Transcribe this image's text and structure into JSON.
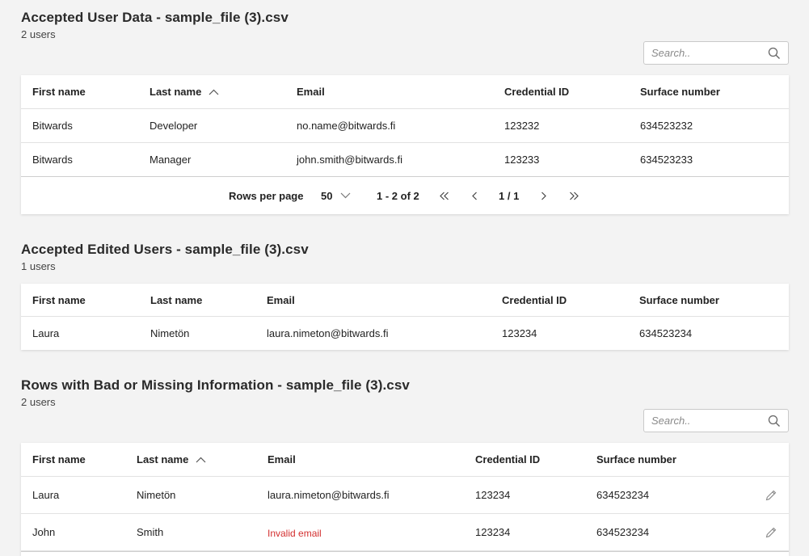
{
  "accepted": {
    "title": "Accepted User Data - sample_file (3).csv",
    "count": "2 users",
    "search_placeholder": "Search..",
    "headers": [
      "First name",
      "Last name",
      "Email",
      "Credential ID",
      "Surface number"
    ],
    "rows": [
      [
        "Bitwards",
        "Developer",
        "no.name@bitwards.fi",
        "123232",
        "634523232"
      ],
      [
        "Bitwards",
        "Manager",
        "john.smith@bitwards.fi",
        "123233",
        "634523233"
      ]
    ],
    "pagination": {
      "rows_per_page_label": "Rows per page",
      "rows_per_page_value": "50",
      "range": "1 - 2 of 2",
      "page": "1 / 1"
    }
  },
  "edited": {
    "title": "Accepted Edited Users - sample_file (3).csv",
    "count": "1 users",
    "headers": [
      "First name",
      "Last name",
      "Email",
      "Credential ID",
      "Surface number"
    ],
    "rows": [
      [
        "Laura",
        "Nimetön",
        "laura.nimeton@bitwards.fi",
        "123234",
        "634523234"
      ]
    ]
  },
  "bad": {
    "title": "Rows with Bad or Missing Information - sample_file (3).csv",
    "count": "2 users",
    "search_placeholder": "Search..",
    "headers": [
      "First name",
      "Last name",
      "Email",
      "Credential ID",
      "Surface number"
    ],
    "rows": [
      [
        "Laura",
        "Nimetön",
        "laura.nimeton@bitwards.fi",
        "123234",
        "634523234"
      ],
      [
        "John",
        "Smith",
        "Invalid email",
        "123234",
        "634523234"
      ]
    ]
  },
  "colors": {
    "error": "#d32f2f",
    "background": "#f3f3f3",
    "card": "#ffffff"
  },
  "icons": {
    "search": "search-icon",
    "sort": "sort-ascending-icon",
    "dropdown": "chevron-down-icon",
    "first": "double-chevron-left-icon",
    "prev": "chevron-left-icon",
    "next": "chevron-right-icon",
    "last": "double-chevron-right-icon",
    "edit": "pencil-icon"
  }
}
